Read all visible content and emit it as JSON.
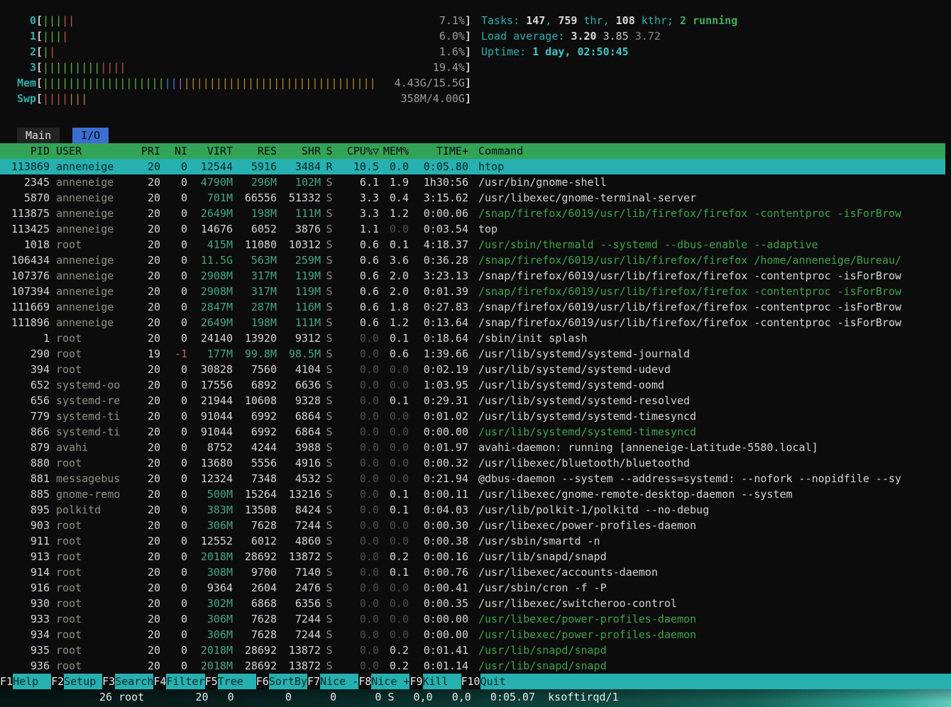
{
  "colors": {
    "cyan": "#2fb0b0",
    "cyan_bright": "#3ec6c6",
    "header_green": "#33a357",
    "selected_cyan": "#27b0b0",
    "fbar_cyan": "#27b0b0",
    "tab_blue": "#3b6ed0",
    "thread_green": "#3fa34c",
    "size_m": "#45a58a",
    "size_g": "#45a56b",
    "green_text": "#3fae5f",
    "bar_green": "#63b23c",
    "bar_red": "#c95252",
    "bar_blue": "#4d78d8",
    "bar_magenta": "#a65bbf",
    "bar_yellow": "#b5892a"
  },
  "meters": {
    "cpu": [
      {
        "label": "  0",
        "value": " 7.1%",
        "segments": [
          {
            "c": "green",
            "n": 3
          },
          {
            "c": "red",
            "n": 2
          }
        ]
      },
      {
        "label": "  1",
        "value": " 6.0%",
        "segments": [
          {
            "c": "green",
            "n": 3
          },
          {
            "c": "red",
            "n": 1
          }
        ]
      },
      {
        "label": "  2",
        "value": " 1.6%",
        "segments": [
          {
            "c": "green",
            "n": 1
          },
          {
            "c": "red",
            "n": 1
          }
        ]
      },
      {
        "label": "  3",
        "value": "19.4%",
        "segments": [
          {
            "c": "green",
            "n": 9
          },
          {
            "c": "red",
            "n": 4
          }
        ]
      }
    ],
    "mem": {
      "label": "Mem",
      "value": "4.43G/15.5G",
      "segments": [
        {
          "c": "green",
          "n": 19
        },
        {
          "c": "blue",
          "n": 2
        },
        {
          "c": "magenta",
          "n": 1
        },
        {
          "c": "yellow",
          "n": 30
        }
      ]
    },
    "swap": {
      "label": "Swp",
      "value": "358M/4.00G",
      "segments": [
        {
          "c": "red",
          "n": 4
        },
        {
          "c": "yellow",
          "n": 3
        }
      ]
    }
  },
  "info_lines": [
    {
      "name": "tasks-summary",
      "segments": [
        {
          "c": "label",
          "t": "Tasks: "
        },
        {
          "c": "bold",
          "t": "147"
        },
        {
          "c": "label",
          "t": ", "
        },
        {
          "c": "bold",
          "t": "759"
        },
        {
          "c": "label",
          "t": " thr, "
        },
        {
          "c": "bold",
          "t": "108"
        },
        {
          "c": "label",
          "t": " kthr; "
        },
        {
          "c": "green",
          "t": "2 running"
        }
      ]
    },
    {
      "name": "load-average",
      "segments": [
        {
          "c": "label",
          "t": "Load average: "
        },
        {
          "c": "bold",
          "t": "3.20 "
        },
        {
          "c": "white",
          "t": "3.85 "
        },
        {
          "c": "shadow",
          "t": "3.72"
        }
      ]
    },
    {
      "name": "uptime",
      "segments": [
        {
          "c": "label",
          "t": "Uptime: "
        },
        {
          "c": "boldcyan",
          "t": "1 day, 02:50:45"
        }
      ]
    }
  ],
  "tabs": [
    {
      "label": "Main",
      "active": true
    },
    {
      "label": "I/O",
      "active": false
    }
  ],
  "table": {
    "columns": [
      "PID",
      "USER",
      "PRI",
      "NI",
      "VIRT",
      "RES",
      "SHR",
      "S",
      "CPU%▽",
      "MEM%",
      "TIME+",
      "Command"
    ],
    "rows": [
      {
        "pid": "113869",
        "user": "anneneige",
        "pri": "20",
        "ni": "0",
        "virt": "12544",
        "res": "5916",
        "shr": "3484",
        "s": "R",
        "cpu": "10.5",
        "mem": "0.0",
        "time": "0:05.80",
        "cmd": "htop",
        "selected": true
      },
      {
        "pid": "2345",
        "user": "anneneige",
        "pri": "20",
        "ni": "0",
        "virt": "4790M",
        "res": "296M",
        "shr": "102M",
        "s": "S",
        "cpu": "6.1",
        "mem": "1.9",
        "time": "1h30:56",
        "cmd": "/usr/bin/gnome-shell"
      },
      {
        "pid": "5870",
        "user": "anneneige",
        "pri": "20",
        "ni": "0",
        "virt": "701M",
        "res": "66556",
        "shr": "51332",
        "s": "S",
        "cpu": "3.3",
        "mem": "0.4",
        "time": "3:15.62",
        "cmd": "/usr/libexec/gnome-terminal-server"
      },
      {
        "pid": "113875",
        "user": "anneneige",
        "pri": "20",
        "ni": "0",
        "virt": "2649M",
        "res": "198M",
        "shr": "111M",
        "s": "S",
        "cpu": "3.3",
        "mem": "1.2",
        "time": "0:00.06",
        "cmd": "/snap/firefox/6019/usr/lib/firefox/firefox -contentproc -isForBrow",
        "thread": true
      },
      {
        "pid": "113425",
        "user": "anneneige",
        "pri": "20",
        "ni": "0",
        "virt": "14676",
        "res": "6052",
        "shr": "3876",
        "s": "S",
        "cpu": "1.1",
        "mem": "0.0",
        "time": "0:03.54",
        "cmd": "top"
      },
      {
        "pid": "1018",
        "user": "root",
        "pri": "20",
        "ni": "0",
        "virt": "415M",
        "res": "11080",
        "shr": "10312",
        "s": "S",
        "cpu": "0.6",
        "mem": "0.1",
        "time": "4:18.37",
        "cmd": "/usr/sbin/thermald --systemd --dbus-enable --adaptive",
        "thread": true
      },
      {
        "pid": "106434",
        "user": "anneneige",
        "pri": "20",
        "ni": "0",
        "virt": "11.5G",
        "res": "563M",
        "shr": "259M",
        "s": "S",
        "cpu": "0.6",
        "mem": "3.6",
        "time": "0:36.28",
        "cmd": "/snap/firefox/6019/usr/lib/firefox/firefox /home/anneneige/Bureau/",
        "thread": true
      },
      {
        "pid": "107376",
        "user": "anneneige",
        "pri": "20",
        "ni": "0",
        "virt": "2908M",
        "res": "317M",
        "shr": "119M",
        "s": "S",
        "cpu": "0.6",
        "mem": "2.0",
        "time": "3:23.13",
        "cmd": "/snap/firefox/6019/usr/lib/firefox/firefox -contentproc -isForBrow"
      },
      {
        "pid": "107394",
        "user": "anneneige",
        "pri": "20",
        "ni": "0",
        "virt": "2908M",
        "res": "317M",
        "shr": "119M",
        "s": "S",
        "cpu": "0.6",
        "mem": "2.0",
        "time": "0:01.39",
        "cmd": "/snap/firefox/6019/usr/lib/firefox/firefox -contentproc -isForBrow",
        "thread": true
      },
      {
        "pid": "111669",
        "user": "anneneige",
        "pri": "20",
        "ni": "0",
        "virt": "2847M",
        "res": "287M",
        "shr": "116M",
        "s": "S",
        "cpu": "0.6",
        "mem": "1.8",
        "time": "0:27.83",
        "cmd": "/snap/firefox/6019/usr/lib/firefox/firefox -contentproc -isForBrow"
      },
      {
        "pid": "111896",
        "user": "anneneige",
        "pri": "20",
        "ni": "0",
        "virt": "2649M",
        "res": "198M",
        "shr": "111M",
        "s": "S",
        "cpu": "0.6",
        "mem": "1.2",
        "time": "0:13.64",
        "cmd": "/snap/firefox/6019/usr/lib/firefox/firefox -contentproc -isForBrow"
      },
      {
        "pid": "1",
        "user": "root",
        "pri": "20",
        "ni": "0",
        "virt": "24140",
        "res": "13920",
        "shr": "9312",
        "s": "S",
        "cpu": "0.0",
        "mem": "0.1",
        "time": "0:18.64",
        "cmd": "/sbin/init splash"
      },
      {
        "pid": "290",
        "user": "root",
        "pri": "19",
        "ni": "-1",
        "virt": "177M",
        "res": "99.8M",
        "shr": "98.5M",
        "s": "S",
        "cpu": "0.0",
        "mem": "0.6",
        "time": "1:39.66",
        "cmd": "/usr/lib/systemd/systemd-journald"
      },
      {
        "pid": "394",
        "user": "root",
        "pri": "20",
        "ni": "0",
        "virt": "30828",
        "res": "7560",
        "shr": "4104",
        "s": "S",
        "cpu": "0.0",
        "mem": "0.0",
        "time": "0:02.19",
        "cmd": "/usr/lib/systemd/systemd-udevd"
      },
      {
        "pid": "652",
        "user": "systemd-oo",
        "pri": "20",
        "ni": "0",
        "virt": "17556",
        "res": "6892",
        "shr": "6636",
        "s": "S",
        "cpu": "0.0",
        "mem": "0.0",
        "time": "1:03.95",
        "cmd": "/usr/lib/systemd/systemd-oomd"
      },
      {
        "pid": "656",
        "user": "systemd-re",
        "pri": "20",
        "ni": "0",
        "virt": "21944",
        "res": "10608",
        "shr": "9328",
        "s": "S",
        "cpu": "0.0",
        "mem": "0.1",
        "time": "0:29.31",
        "cmd": "/usr/lib/systemd/systemd-resolved"
      },
      {
        "pid": "779",
        "user": "systemd-ti",
        "pri": "20",
        "ni": "0",
        "virt": "91044",
        "res": "6992",
        "shr": "6864",
        "s": "S",
        "cpu": "0.0",
        "mem": "0.0",
        "time": "0:01.02",
        "cmd": "/usr/lib/systemd/systemd-timesyncd"
      },
      {
        "pid": "866",
        "user": "systemd-ti",
        "pri": "20",
        "ni": "0",
        "virt": "91044",
        "res": "6992",
        "shr": "6864",
        "s": "S",
        "cpu": "0.0",
        "mem": "0.0",
        "time": "0:00.00",
        "cmd": "/usr/lib/systemd/systemd-timesyncd",
        "thread": true
      },
      {
        "pid": "879",
        "user": "avahi",
        "pri": "20",
        "ni": "0",
        "virt": "8752",
        "res": "4244",
        "shr": "3988",
        "s": "S",
        "cpu": "0.0",
        "mem": "0.0",
        "time": "0:01.97",
        "cmd": "avahi-daemon: running [anneneige-Latitude-5580.local]"
      },
      {
        "pid": "880",
        "user": "root",
        "pri": "20",
        "ni": "0",
        "virt": "13680",
        "res": "5556",
        "shr": "4916",
        "s": "S",
        "cpu": "0.0",
        "mem": "0.0",
        "time": "0:00.32",
        "cmd": "/usr/libexec/bluetooth/bluetoothd"
      },
      {
        "pid": "881",
        "user": "messagebus",
        "pri": "20",
        "ni": "0",
        "virt": "12324",
        "res": "7348",
        "shr": "4532",
        "s": "S",
        "cpu": "0.0",
        "mem": "0.0",
        "time": "0:21.94",
        "cmd": "@dbus-daemon --system --address=systemd: --nofork --nopidfile --sy"
      },
      {
        "pid": "885",
        "user": "gnome-remo",
        "pri": "20",
        "ni": "0",
        "virt": "500M",
        "res": "15264",
        "shr": "13216",
        "s": "S",
        "cpu": "0.0",
        "mem": "0.1",
        "time": "0:00.11",
        "cmd": "/usr/libexec/gnome-remote-desktop-daemon --system"
      },
      {
        "pid": "895",
        "user": "polkitd",
        "pri": "20",
        "ni": "0",
        "virt": "383M",
        "res": "13508",
        "shr": "8424",
        "s": "S",
        "cpu": "0.0",
        "mem": "0.1",
        "time": "0:04.03",
        "cmd": "/usr/lib/polkit-1/polkitd --no-debug"
      },
      {
        "pid": "903",
        "user": "root",
        "pri": "20",
        "ni": "0",
        "virt": "306M",
        "res": "7628",
        "shr": "7244",
        "s": "S",
        "cpu": "0.0",
        "mem": "0.0",
        "time": "0:00.30",
        "cmd": "/usr/libexec/power-profiles-daemon"
      },
      {
        "pid": "911",
        "user": "root",
        "pri": "20",
        "ni": "0",
        "virt": "12552",
        "res": "6012",
        "shr": "4860",
        "s": "S",
        "cpu": "0.0",
        "mem": "0.0",
        "time": "0:00.38",
        "cmd": "/usr/sbin/smartd -n"
      },
      {
        "pid": "913",
        "user": "root",
        "pri": "20",
        "ni": "0",
        "virt": "2018M",
        "res": "28692",
        "shr": "13872",
        "s": "S",
        "cpu": "0.0",
        "mem": "0.2",
        "time": "0:00.16",
        "cmd": "/usr/lib/snapd/snapd"
      },
      {
        "pid": "914",
        "user": "root",
        "pri": "20",
        "ni": "0",
        "virt": "308M",
        "res": "9700",
        "shr": "7140",
        "s": "S",
        "cpu": "0.0",
        "mem": "0.1",
        "time": "0:00.76",
        "cmd": "/usr/libexec/accounts-daemon"
      },
      {
        "pid": "916",
        "user": "root",
        "pri": "20",
        "ni": "0",
        "virt": "9364",
        "res": "2604",
        "shr": "2476",
        "s": "S",
        "cpu": "0.0",
        "mem": "0.0",
        "time": "0:00.41",
        "cmd": "/usr/sbin/cron -f -P"
      },
      {
        "pid": "930",
        "user": "root",
        "pri": "20",
        "ni": "0",
        "virt": "302M",
        "res": "6868",
        "shr": "6356",
        "s": "S",
        "cpu": "0.0",
        "mem": "0.0",
        "time": "0:00.35",
        "cmd": "/usr/libexec/switcheroo-control"
      },
      {
        "pid": "933",
        "user": "root",
        "pri": "20",
        "ni": "0",
        "virt": "306M",
        "res": "7628",
        "shr": "7244",
        "s": "S",
        "cpu": "0.0",
        "mem": "0.0",
        "time": "0:00.00",
        "cmd": "/usr/libexec/power-profiles-daemon",
        "thread": true
      },
      {
        "pid": "934",
        "user": "root",
        "pri": "20",
        "ni": "0",
        "virt": "306M",
        "res": "7628",
        "shr": "7244",
        "s": "S",
        "cpu": "0.0",
        "mem": "0.0",
        "time": "0:00.00",
        "cmd": "/usr/libexec/power-profiles-daemon",
        "thread": true
      },
      {
        "pid": "935",
        "user": "root",
        "pri": "20",
        "ni": "0",
        "virt": "2018M",
        "res": "28692",
        "shr": "13872",
        "s": "S",
        "cpu": "0.0",
        "mem": "0.2",
        "time": "0:01.41",
        "cmd": "/usr/lib/snapd/snapd",
        "thread": true
      },
      {
        "pid": "936",
        "user": "root",
        "pri": "20",
        "ni": "0",
        "virt": "2018M",
        "res": "28692",
        "shr": "13872",
        "s": "S",
        "cpu": "0.0",
        "mem": "0.2",
        "time": "0:01.14",
        "cmd": "/usr/lib/snapd/snapd",
        "thread": true
      }
    ]
  },
  "fkeys": [
    {
      "key": "F1",
      "label": "Help"
    },
    {
      "key": "F2",
      "label": "Setup"
    },
    {
      "key": "F3",
      "label": "Search"
    },
    {
      "key": "F4",
      "label": "Filter"
    },
    {
      "key": "F5",
      "label": "Tree"
    },
    {
      "key": "F6",
      "label": "SortBy"
    },
    {
      "key": "F7",
      "label": "Nice -"
    },
    {
      "key": "F8",
      "label": "Nice +"
    },
    {
      "key": "F9",
      "label": "Kill"
    },
    {
      "key": "F10",
      "label": "Quit"
    }
  ],
  "background_window": {
    "partial_line": "26 root        20   0        0      0      0 S   0,0   0,0   0:05.07  ksoftirqd/1"
  }
}
